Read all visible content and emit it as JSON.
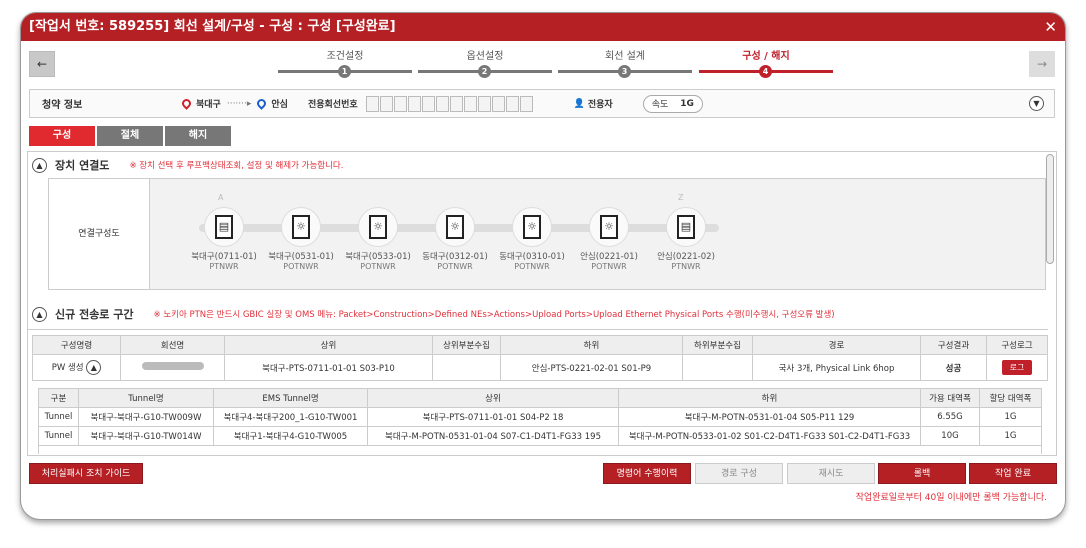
{
  "window": {
    "title": "[작업서 번호: 589255] 회선 설계/구성 - 구성 : 구성 [구성완료]",
    "close": "✕"
  },
  "nav": {
    "prev": "←",
    "next": "→"
  },
  "steps": [
    {
      "num": "1",
      "label": "조건설정"
    },
    {
      "num": "2",
      "label": "옵션설정"
    },
    {
      "num": "3",
      "label": "회선 설계"
    },
    {
      "num": "4",
      "label": "구성 / 해지"
    }
  ],
  "info": {
    "title": "청약 정보",
    "from": "북대구",
    "to": "안심",
    "arrow": "·······▸",
    "line_no_label": "전용회선번호",
    "user": "전용자",
    "speed_label": "속도",
    "speed": "1G"
  },
  "tabs": [
    "구성",
    "절체",
    "해지"
  ],
  "section1": {
    "title": "장치 연결도",
    "note": "※ 장치 선택 후 루프백상태조회, 설정 및 해제가 가능합니다.",
    "label": "연결구성도",
    "a": "A",
    "z": "Z",
    "nodes": [
      {
        "name": "북대구(0711-01)",
        "type": "PTNWR"
      },
      {
        "name": "북대구(0531-01)",
        "type": "POTNWR"
      },
      {
        "name": "북대구(0533-01)",
        "type": "POTNWR"
      },
      {
        "name": "동대구(0312-01)",
        "type": "POTNWR"
      },
      {
        "name": "동대구(0310-01)",
        "type": "POTNWR"
      },
      {
        "name": "안심(0221-01)",
        "type": "POTNWR"
      },
      {
        "name": "안심(0221-02)",
        "type": "PTNWR"
      }
    ]
  },
  "section2": {
    "title": "신규 전송로 구간",
    "note": "※ 노키아 PTN은 반드시 GBIC 실장 및 OMS 메뉴: Packet>Construction>Defined NEs>Actions>Upload Ports>Upload Ethernet Physical Ports 수행(미수행시, 구성오류 발생)",
    "headers": [
      "구성명령",
      "회선명",
      "상위",
      "상위부분수집",
      "하위",
      "하위부분수집",
      "경로",
      "구성결과",
      "구성로그"
    ],
    "row": {
      "cmd": "PW 생성",
      "upper": "북대구-PTS-0711-01-01 S03-P10",
      "upper_part": "",
      "lower": "안심-PTS-0221-02-01 S01-P9",
      "lower_part": "",
      "path": "국사 3개, Physical Link 6hop",
      "result": "성공",
      "log": "로그"
    },
    "sub_headers": [
      "구분",
      "Tunnel명",
      "EMS Tunnel명",
      "상위",
      "하위",
      "가용 대역폭",
      "할당 대역폭"
    ],
    "sub_rows": [
      [
        "Tunnel",
        "북대구-북대구-G10-TW009W",
        "북대구4-북대구200_1-G10-TW001",
        "북대구-PTS-0711-01-01 S04-P2 18",
        "북대구-M-POTN-0531-01-04 S05-P11 129",
        "6.55G",
        "1G"
      ],
      [
        "Tunnel",
        "북대구-북대구-G10-TW014W",
        "북대구1-북대구4-G10-TW005",
        "북대구-M-POTN-0531-01-04 S07-C1-D4T1-FG33 195",
        "북대구-M-POTN-0533-01-02 S01-C2-D4T1-FG33 S01-C2-D4T1-FG33",
        "10G",
        "1G"
      ]
    ]
  },
  "buttons": {
    "guide": "처리실패시 조치 가이드",
    "history": "명령어 수행이력",
    "route": "경로 구성",
    "retry": "재시도",
    "rollback": "롤백",
    "complete": "작업 완료"
  },
  "footer_note": "작업완료일로부터 40일 이내에만 롤백 가능합니다.",
  "colors": {
    "brand": "#b52025",
    "accent": "#e02a2f"
  }
}
